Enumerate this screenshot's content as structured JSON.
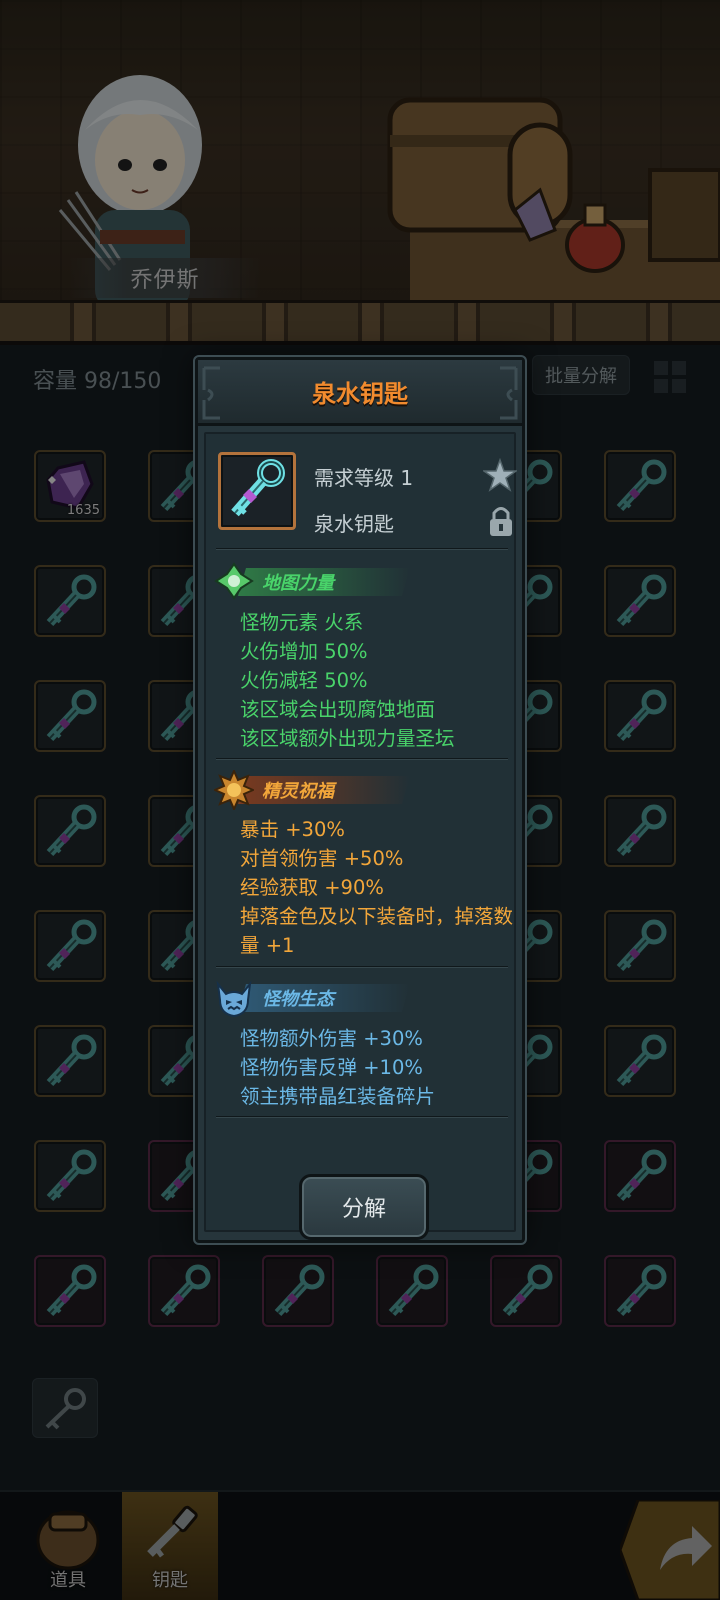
{
  "character": {
    "name": "乔伊斯"
  },
  "inventory": {
    "capacity_label": "容量 98/150",
    "bulk_decompose_label": "批量分解",
    "first_item_count": "1635"
  },
  "bottom_nav": {
    "tabs": [
      {
        "label": "道具",
        "active": false
      },
      {
        "label": "钥匙",
        "active": true
      }
    ]
  },
  "modal": {
    "title": "泉水钥匙",
    "required_level": "需求等级 1",
    "item_name": "泉水钥匙",
    "sections": [
      {
        "title": "地图力量",
        "color": "#49d36a",
        "lines": [
          "怪物元素 火系",
          "火伤增加 50%",
          "火伤减轻 50%",
          "该区域会出现腐蚀地面",
          "该区域额外出现力量圣坛"
        ]
      },
      {
        "title": "精灵祝福",
        "color": "#f2a63a",
        "lines": [
          "暴击 +30%",
          "对首领伤害 +50%",
          "经验获取 +90%",
          "掉落金色及以下装备时，掉落数量 +1"
        ]
      },
      {
        "title": "怪物生态",
        "color": "#6bb8e6",
        "lines": [
          "怪物额外伤害 +30%",
          "怪物伤害反弹 +10%",
          "领主携带晶红装备碎片"
        ]
      }
    ],
    "decompose_label": "分解"
  },
  "colors": {
    "title_orange": "#f28b2e",
    "rarity_gold": "#b3733c",
    "rarity_purple": "#5b2a48"
  }
}
